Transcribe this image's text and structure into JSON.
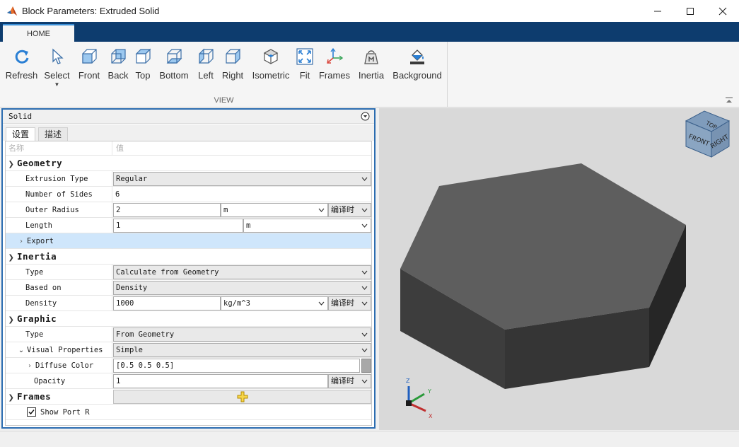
{
  "window": {
    "title": "Block Parameters: Extruded Solid",
    "controls": [
      "minimize",
      "maximize",
      "close"
    ]
  },
  "ribbon": {
    "tab": "HOME",
    "group_label": "VIEW",
    "buttons": [
      {
        "label": "Refresh",
        "icon": "refresh-icon"
      },
      {
        "label": "Select",
        "icon": "select-cursor-icon",
        "has_menu": true
      },
      {
        "label": "Front",
        "icon": "front-view-icon"
      },
      {
        "label": "Back",
        "icon": "back-view-icon"
      },
      {
        "label": "Top",
        "icon": "top-view-icon"
      },
      {
        "label": "Bottom",
        "icon": "bottom-view-icon"
      },
      {
        "label": "Left",
        "icon": "left-view-icon"
      },
      {
        "label": "Right",
        "icon": "right-view-icon"
      },
      {
        "label": "Isometric",
        "icon": "isometric-view-icon"
      },
      {
        "label": "Fit",
        "icon": "fit-icon"
      },
      {
        "label": "Frames",
        "icon": "frames-icon"
      },
      {
        "label": "Inertia",
        "icon": "inertia-icon"
      },
      {
        "label": "Background",
        "icon": "background-paint-icon"
      }
    ]
  },
  "panel": {
    "title": "Solid",
    "tabs": [
      "设置",
      "描述"
    ],
    "header": {
      "name": "名称",
      "value": "值"
    },
    "geometry": {
      "label": "Geometry",
      "extrusion_type": {
        "name": "Extrusion Type",
        "value": "Regular"
      },
      "number_of_sides": {
        "name": "Number of Sides",
        "value": "6"
      },
      "outer_radius": {
        "name": "Outer Radius",
        "value": "2",
        "unit": "m",
        "eval": "编译时"
      },
      "length": {
        "name": "Length",
        "value": "1",
        "unit": "m"
      },
      "export": {
        "name": "Export"
      }
    },
    "inertia": {
      "label": "Inertia",
      "type": {
        "name": "Type",
        "value": "Calculate from Geometry"
      },
      "based_on": {
        "name": "Based on",
        "value": "Density"
      },
      "density": {
        "name": "Density",
        "value": "1000",
        "unit": "kg/m^3",
        "eval": "编译时"
      }
    },
    "graphic": {
      "label": "Graphic",
      "type": {
        "name": "Type",
        "value": "From Geometry"
      },
      "visual_properties": {
        "name": "Visual Properties",
        "value": "Simple"
      },
      "diffuse_color": {
        "name": "Diffuse Color",
        "value": "[0.5 0.5 0.5]"
      },
      "opacity": {
        "name": "Opacity",
        "value": "1",
        "eval": "编译时"
      }
    },
    "frames": {
      "label": "Frames",
      "show_port_r": {
        "name": "Show Port R",
        "checked": true
      }
    }
  },
  "view": {
    "cube_faces": {
      "top": "TOP",
      "front": "FRONT",
      "right": "RIGHT"
    },
    "axes": {
      "x": "X",
      "y": "Y",
      "z": "Z"
    },
    "background": "#d9d9d9",
    "solid_color": "#5e5e5e"
  },
  "colors": {
    "accent": "#0d3c6e",
    "panel_border": "#2b6cb0",
    "selected_row": "#cfe6fb"
  }
}
